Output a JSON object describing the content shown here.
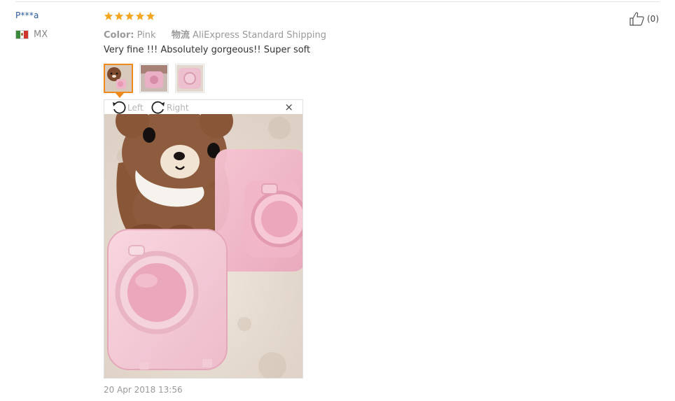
{
  "review": {
    "user_name": "P***a",
    "country_code": "MX",
    "rating_stars": 5,
    "color_label": "Color:",
    "color_value": "Pink",
    "shipping_label": "物流",
    "shipping_value": "AliExpress Standard Shipping",
    "text": "Very fine !!! Absolutely gorgeous!! Super soft",
    "date": "20 Apr 2018 13:56",
    "helpful_count": "(0)"
  },
  "viewer": {
    "rotate_left_label": "Left",
    "rotate_right_label": "Right",
    "close_symbol": "×"
  },
  "colors": {
    "star": "#f5a623",
    "accent": "#f08a1c",
    "username": "#2a5c9e"
  },
  "icons": [
    "thumbs-up-icon",
    "star-icon",
    "mexico-flag-icon",
    "rotate-left-icon",
    "rotate-right-icon",
    "close-icon"
  ]
}
